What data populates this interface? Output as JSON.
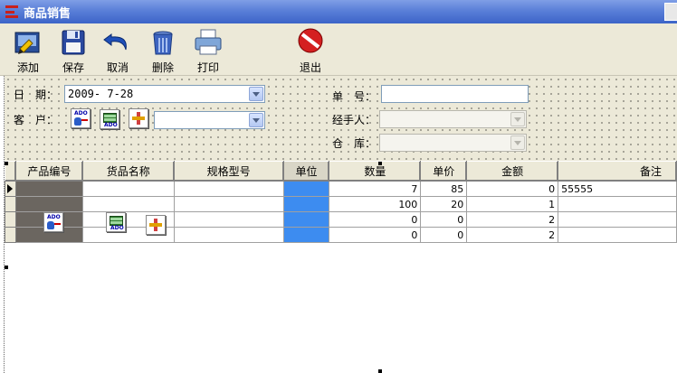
{
  "window": {
    "title": "商品销售"
  },
  "toolbar": {
    "add": "添加",
    "save": "保存",
    "cancel": "取消",
    "delete": "删除",
    "print": "打印",
    "exit": "退出"
  },
  "form": {
    "date_label": "日　期：",
    "date_value": "2009- 7-28",
    "customer_label": "客　户：",
    "customer_value": "",
    "order_no_label": "单　号：",
    "order_no_value": "",
    "handler_label": "经手人：",
    "handler_value": "",
    "warehouse_label": "仓　库：",
    "warehouse_value": ""
  },
  "grid": {
    "columns": [
      "产品编号",
      "货品名称",
      "规格型号",
      "单位",
      "数量",
      "单价",
      "金额",
      "备注"
    ],
    "rows": [
      {
        "code": "",
        "name": "",
        "spec": "",
        "unit": "",
        "qty": "7",
        "price": "85",
        "amount": "0",
        "remark": "55555"
      },
      {
        "code": "",
        "name": "",
        "spec": "",
        "unit": "",
        "qty": "100",
        "price": "20",
        "amount": "1",
        "remark": ""
      },
      {
        "code": "",
        "name": "",
        "spec": "",
        "unit": "",
        "qty": "0",
        "price": "0",
        "amount": "2",
        "remark": ""
      },
      {
        "code": "",
        "name": "",
        "spec": "",
        "unit": "",
        "qty": "0",
        "price": "0",
        "amount": "2",
        "remark": ""
      }
    ]
  },
  "icons": {
    "app": "app-logo-icon",
    "add": "add-record-icon",
    "save": "floppy-disk-icon",
    "cancel": "undo-arrow-icon",
    "delete": "trash-can-icon",
    "print": "printer-icon",
    "exit": "stop-sign-icon",
    "ado": "ado-connection-icon",
    "grid": "data-grid-icon",
    "nav": "navigator-icon"
  },
  "colors": {
    "titlebar": "#3c64c8",
    "face": "#ece9d8",
    "selected_column": "#3d8cf0",
    "exit_red": "#d42020"
  }
}
